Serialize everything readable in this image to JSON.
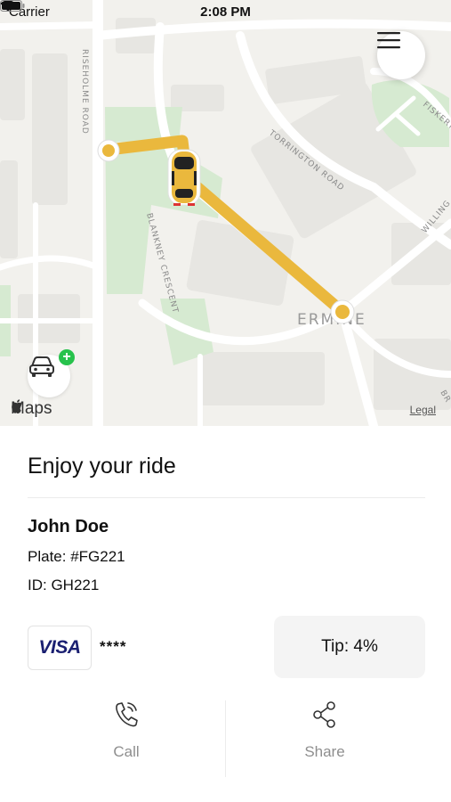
{
  "status_bar": {
    "carrier": "Carrier",
    "time": "2:08 PM"
  },
  "map": {
    "street_labels": [
      "RISEHOLME ROAD",
      "TORRINGTON ROAD",
      "BLANKNEY CRESCENT",
      "FISKERTON",
      "WILLING",
      "ERMINE",
      "BR"
    ],
    "attribution": "Maps",
    "legal": "Legal",
    "route_color": "#eab83d"
  },
  "ride": {
    "title": "Enjoy your ride",
    "driver_name": "John Doe",
    "plate": "Plate: #FG221",
    "id": "ID: GH221",
    "card_brand": "VISA",
    "card_masked": "****",
    "tip": "Tip: 4%"
  },
  "actions": {
    "call_label": "Call",
    "share_label": "Share"
  },
  "icons": {
    "menu": "hamburger-menu-icon",
    "add_car": "car-icon",
    "call": "phone-icon",
    "share": "share-icon"
  }
}
